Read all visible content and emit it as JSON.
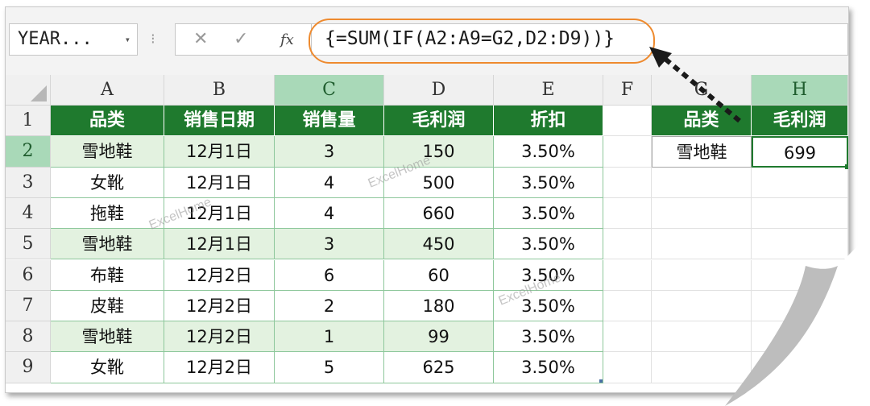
{
  "name_box": {
    "value": "YEAR...",
    "dropdown": "▾"
  },
  "formula_bar": {
    "separator": "⁝",
    "cancel_icon": "✕",
    "enter_icon": "✓",
    "fx_label": "fx",
    "formula": "{=SUM(IF(A2:A9=G2,D2:D9))}"
  },
  "columns": [
    "A",
    "B",
    "C",
    "D",
    "E",
    "F",
    "G",
    "H"
  ],
  "rows": [
    "1",
    "2",
    "3",
    "4",
    "5",
    "6",
    "7",
    "8",
    "9"
  ],
  "table": {
    "headers": [
      "品类",
      "销售日期",
      "销售量",
      "毛利润",
      "折扣"
    ],
    "rows": [
      [
        "雪地鞋",
        "12月1日",
        "3",
        "150",
        "3.50%"
      ],
      [
        "女靴",
        "12月1日",
        "4",
        "500",
        "3.50%"
      ],
      [
        "拖鞋",
        "12月1日",
        "4",
        "660",
        "3.50%"
      ],
      [
        "雪地鞋",
        "12月1日",
        "3",
        "450",
        "3.50%"
      ],
      [
        "布鞋",
        "12月2日",
        "6",
        "60",
        "3.50%"
      ],
      [
        "皮鞋",
        "12月2日",
        "2",
        "180",
        "3.50%"
      ],
      [
        "雪地鞋",
        "12月2日",
        "1",
        "99",
        "3.50%"
      ],
      [
        "女靴",
        "12月2日",
        "5",
        "625",
        "3.50%"
      ]
    ]
  },
  "result": {
    "headers": [
      "品类",
      "毛利润"
    ],
    "category": "雪地鞋",
    "value": "699"
  },
  "watermarks": [
    "ExcelHome",
    "ExcelHome",
    "ExcelHome"
  ],
  "colors": {
    "header_green": "#1f7a2e",
    "highlight_row": "#e3f2e0",
    "formula_outline": "#ee8a2e",
    "selected_header": "#a9d9b8"
  }
}
